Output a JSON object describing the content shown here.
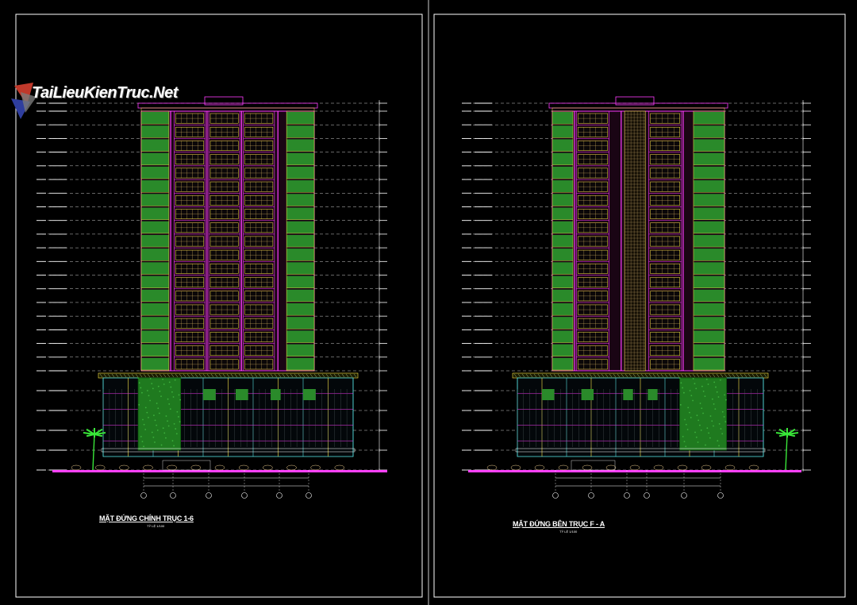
{
  "watermark": {
    "text": "TaiLieuKienTruc.Net"
  },
  "sheets": [
    {
      "caption": "MẶT ĐỨNG CHÍNH TRỤC 1-6",
      "scale": "TỶ LỆ 1/100"
    },
    {
      "caption": "MẶT ĐỨNG BÊN TRỤC F - A",
      "scale": "TỶ LỆ 1/100"
    }
  ],
  "colors": {
    "frame": "#ffffff",
    "magenta": "#ff3cff",
    "yellow": "#ffe94a",
    "green": "#2a8a2a",
    "cyan": "#55e0e0",
    "ground": "#ff40ff"
  }
}
